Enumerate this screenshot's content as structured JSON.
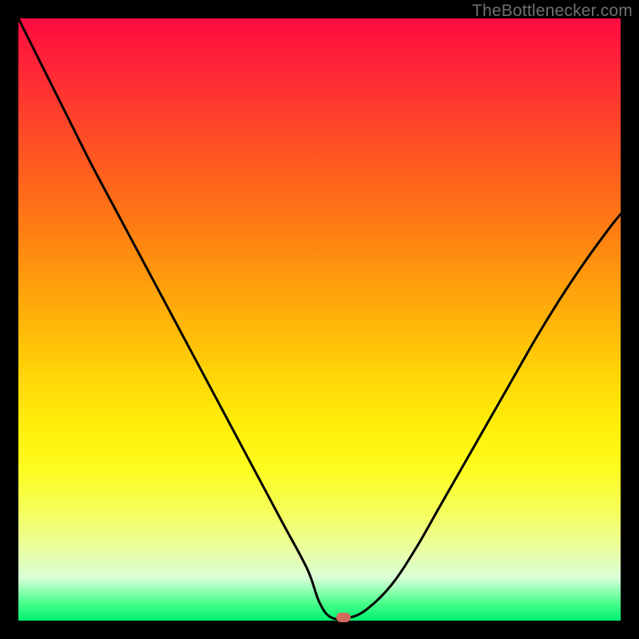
{
  "watermark": "TheBottlenecker.com",
  "chart_data": {
    "type": "line",
    "title": "",
    "xlabel": "",
    "ylabel": "",
    "xlim": [
      0,
      100
    ],
    "ylim": [
      0,
      100
    ],
    "x": [
      0,
      4,
      8,
      12,
      16,
      20,
      24,
      28,
      32,
      36,
      40,
      44,
      48,
      50,
      52,
      55,
      58,
      62,
      66,
      70,
      74,
      78,
      82,
      86,
      90,
      94,
      98,
      100
    ],
    "values": [
      100,
      92,
      84,
      76,
      68.5,
      61,
      53.5,
      46,
      38.5,
      31,
      23.5,
      16,
      8.5,
      3,
      0.5,
      0.5,
      2,
      6,
      12,
      19,
      26,
      33,
      40,
      47,
      53.5,
      59.5,
      65,
      67.5
    ],
    "marker": {
      "x": 54,
      "y": 0.5
    },
    "notes": "x and y are percent of plot area; y increases upward; values estimated from pixels"
  }
}
